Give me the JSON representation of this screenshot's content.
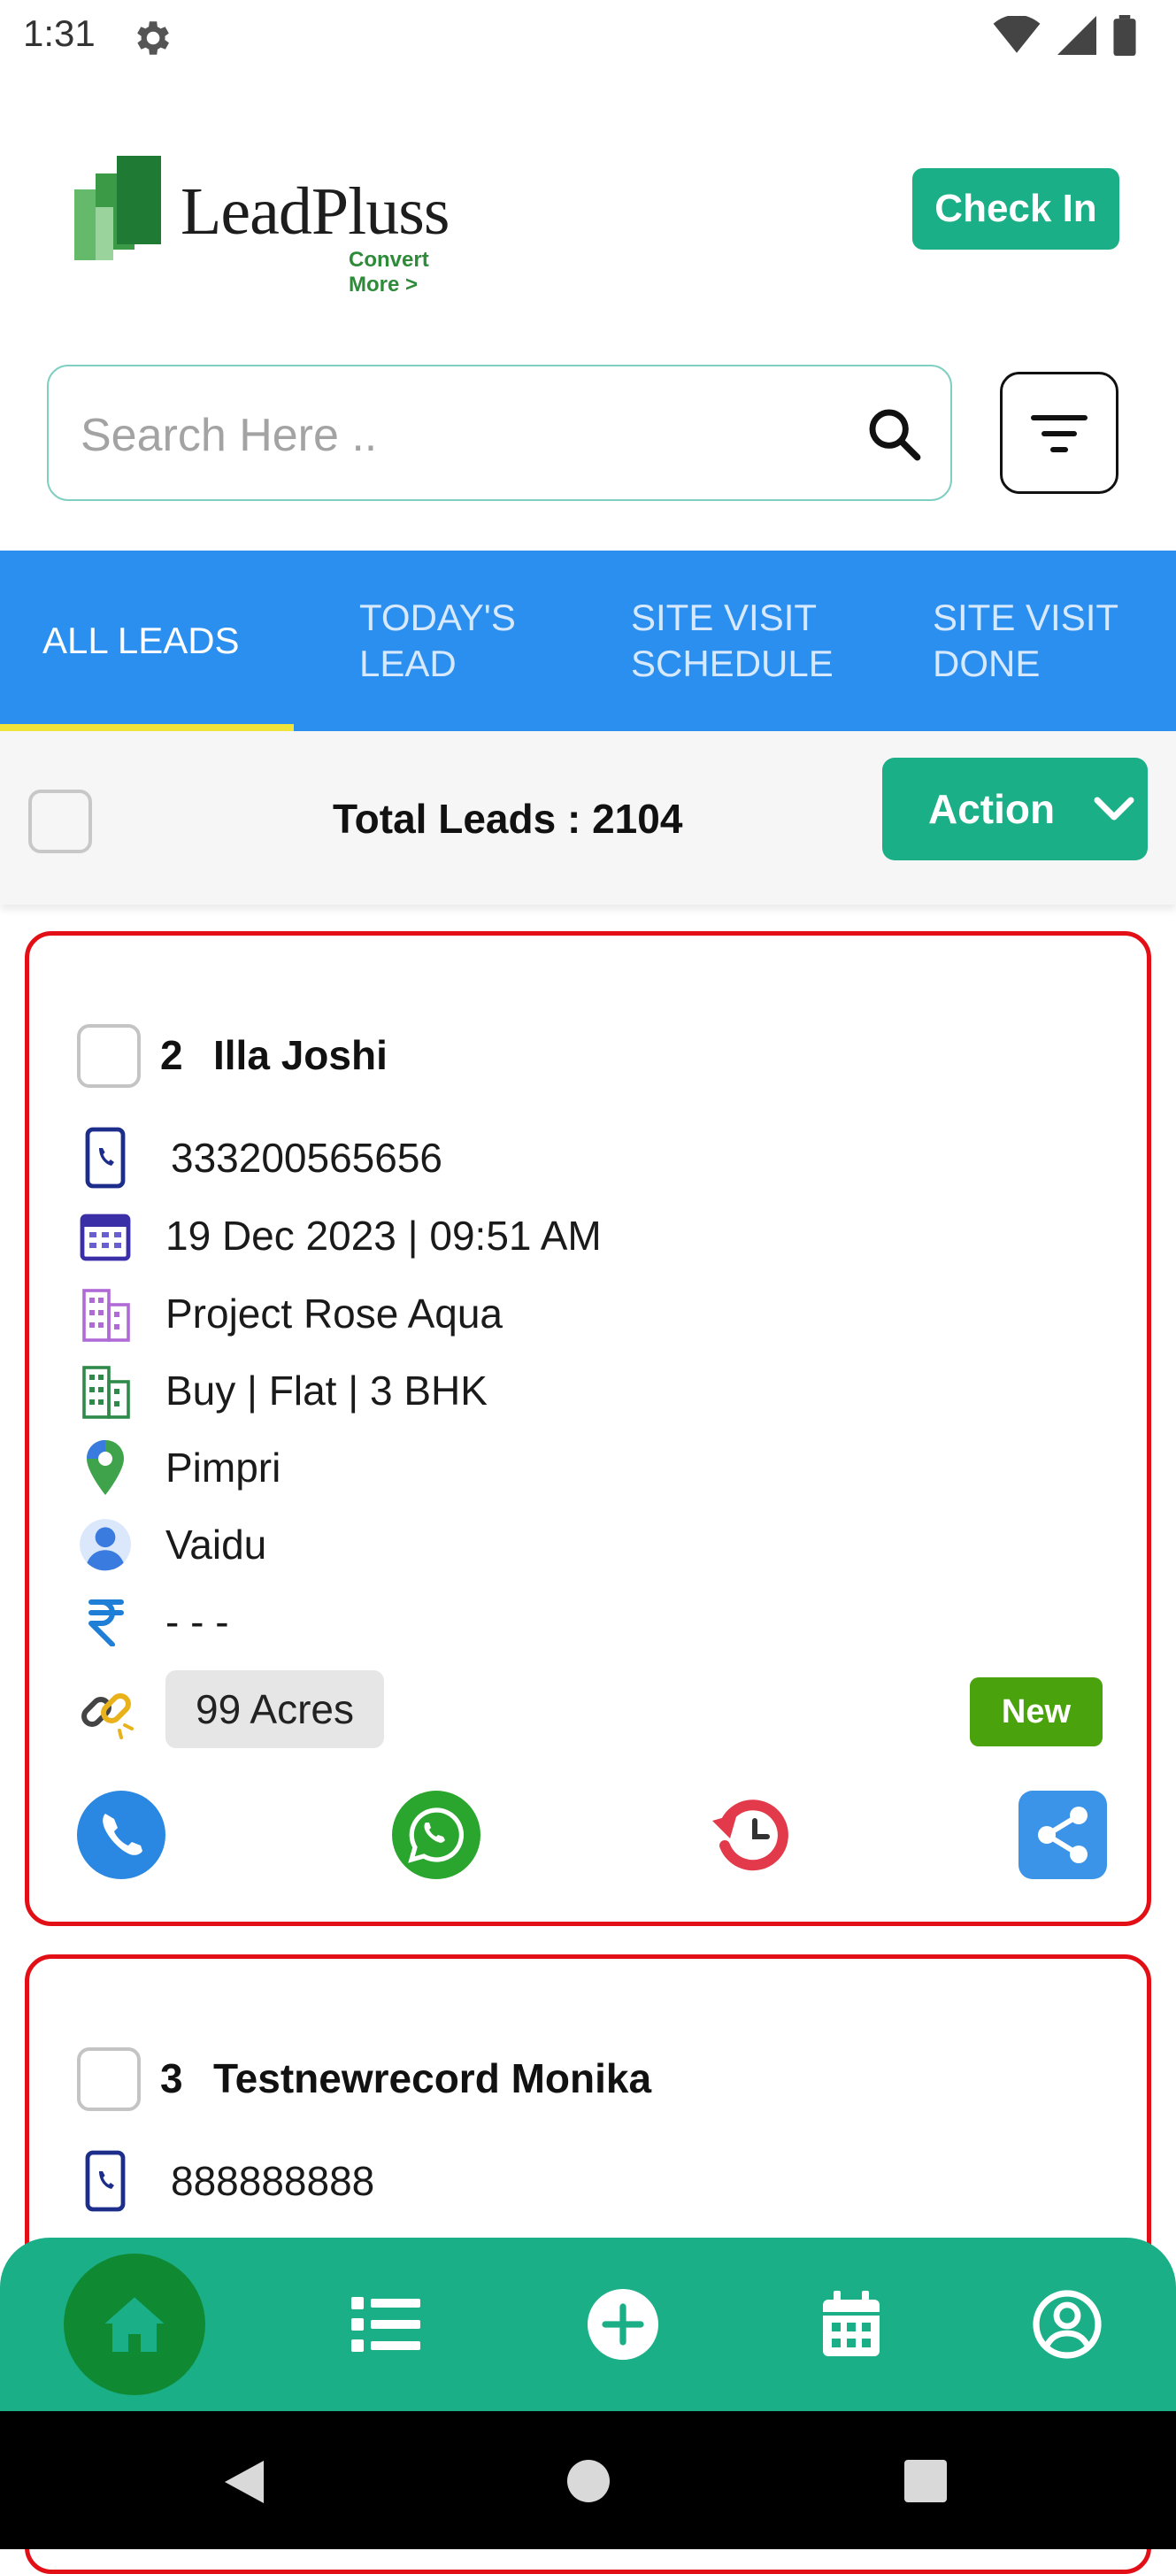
{
  "status_bar": {
    "time": "1:31"
  },
  "header": {
    "brand": "LeadPluss",
    "tagline": "Convert More >",
    "check_in_label": "Check In"
  },
  "search": {
    "placeholder": "Search Here .."
  },
  "tabs": [
    {
      "label": "ALL LEADS",
      "active": true
    },
    {
      "label": "TODAY'S\nLEAD",
      "active": false
    },
    {
      "label": "SITE VISIT\nSCHEDULE",
      "active": false
    },
    {
      "label": "SITE VISIT\nDONE",
      "active": false
    }
  ],
  "summary": {
    "total_label": "Total Leads : 2104",
    "action_label": "Action"
  },
  "leads": [
    {
      "number": "2",
      "name": "Illa Joshi",
      "phone": "333200565656",
      "datetime": "19 Dec 2023 | 09:51 AM",
      "project": "Project Rose Aqua",
      "requirement": "Buy | Flat | 3 BHK",
      "location": "Pimpri",
      "assignee": "Vaidu",
      "budget": "- - -",
      "source": "99 Acres",
      "status": "New"
    },
    {
      "number": "3",
      "name": "Testnewrecord Monika",
      "phone": "888888888"
    }
  ],
  "colors": {
    "accent": "#1aaf87",
    "tab_bar": "#2b8ff0",
    "tab_indicator": "#f0e43a",
    "card_border": "#e30f16",
    "status_new": "#4aa30d"
  },
  "icons": {
    "bottom_nav": [
      "home-icon",
      "list-icon",
      "add-circle-icon",
      "calendar-icon",
      "profile-icon"
    ],
    "lead_actions": [
      "phone-icon",
      "whatsapp-icon",
      "history-icon",
      "share-icon"
    ]
  }
}
